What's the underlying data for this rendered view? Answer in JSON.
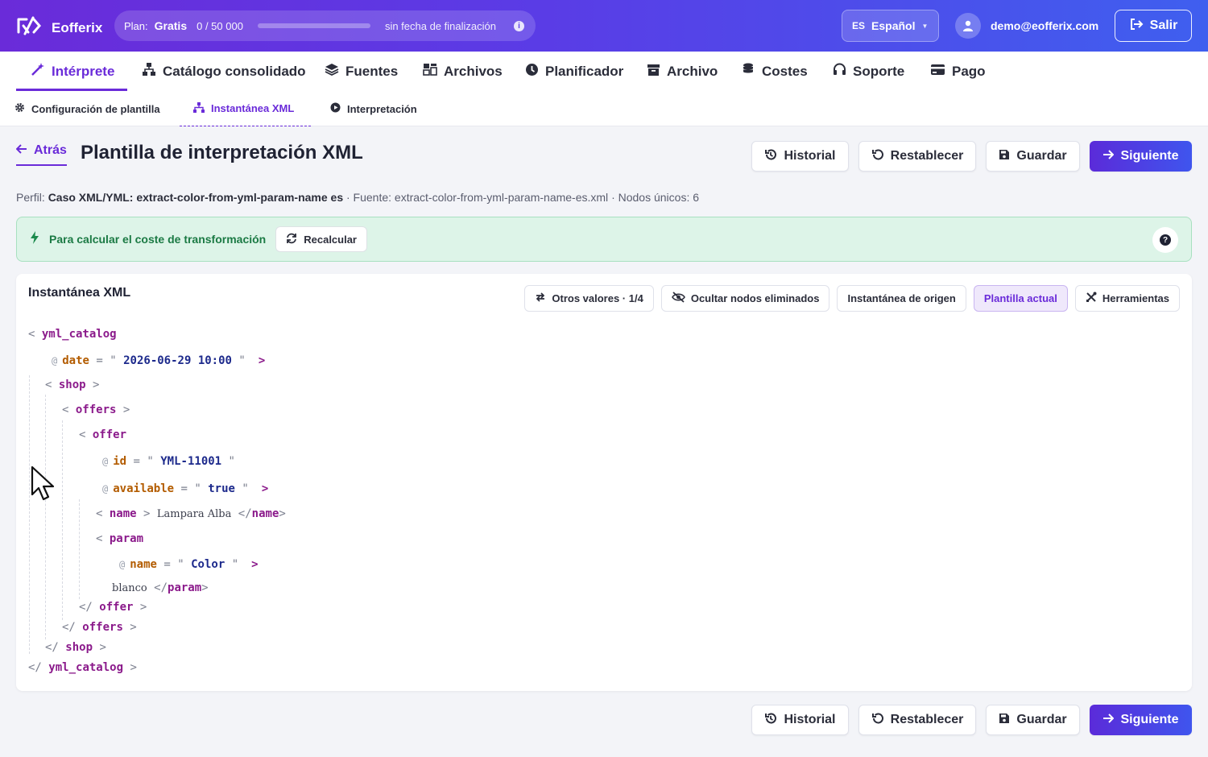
{
  "app": {
    "name": "Eofferix",
    "plan": {
      "label": "Plan:",
      "name": "Gratis",
      "usage": "0 / 50 000",
      "progress": 0,
      "end_date": "sin fecha de finalización"
    },
    "language": {
      "code": "ES",
      "name": "Español"
    },
    "user_email": "demo@eofferix.com",
    "logout_label": "Salir"
  },
  "nav": {
    "main_tabs": [
      {
        "label": "Intérprete",
        "icon": "magic-wand-icon",
        "active": true
      },
      {
        "label": "Catálogo consolidado",
        "icon": "sitemap-icon"
      },
      {
        "label": "Fuentes",
        "icon": "layers-icon"
      },
      {
        "label": "Archivos",
        "icon": "table-icon"
      },
      {
        "label": "Planificador",
        "icon": "clock-icon"
      },
      {
        "label": "Archivo",
        "icon": "archive-icon"
      },
      {
        "label": "Costes",
        "icon": "coins-icon"
      },
      {
        "label": "Soporte",
        "icon": "headset-icon"
      },
      {
        "label": "Pago",
        "icon": "credit-card-icon"
      }
    ],
    "sub_tabs": [
      {
        "label": "Configuración de plantilla",
        "icon": "gear-icon"
      },
      {
        "label": "Instantánea XML",
        "icon": "sitemap-icon",
        "active": true
      },
      {
        "label": "Interpretación",
        "icon": "play-circle-icon"
      }
    ]
  },
  "page": {
    "back_label": "Atrás",
    "title": "Plantilla de interpretación XML",
    "actions": {
      "history": "Historial",
      "reset": "Restablecer",
      "save": "Guardar",
      "next": "Siguiente"
    },
    "profile": {
      "label": "Perfil:",
      "name": "Caso XML/YML: extract-color-from-yml-param-name es",
      "source": "· Fuente: extract-color-from-yml-param-name-es.xml",
      "nodes": "· Nodos únicos: 6"
    },
    "alert": {
      "text": "Para calcular el coste de transformación",
      "button": "Recalcular"
    }
  },
  "snapshot": {
    "title": "Instantánea XML",
    "tools": {
      "other_values": "Otros valores · 1/4",
      "hide_deleted": "Ocultar nodos eliminados",
      "source_snapshot": "Instantánea de origen",
      "current_template": "Plantilla actual",
      "tools": "Herramientas"
    },
    "xml": {
      "root": "yml_catalog",
      "date_attr": "date",
      "date_val": "2026-06-29 10:00",
      "shop": "shop",
      "offers": "offers",
      "offer": "offer",
      "id_attr": "id",
      "id_val": "YML-11001",
      "available_attr": "available",
      "available_val": "true",
      "name_tag": "name",
      "name_text": "Lampara Alba",
      "param_tag": "param",
      "param_attr": "name",
      "param_attr_val": "Color",
      "param_text": "blanco"
    }
  }
}
